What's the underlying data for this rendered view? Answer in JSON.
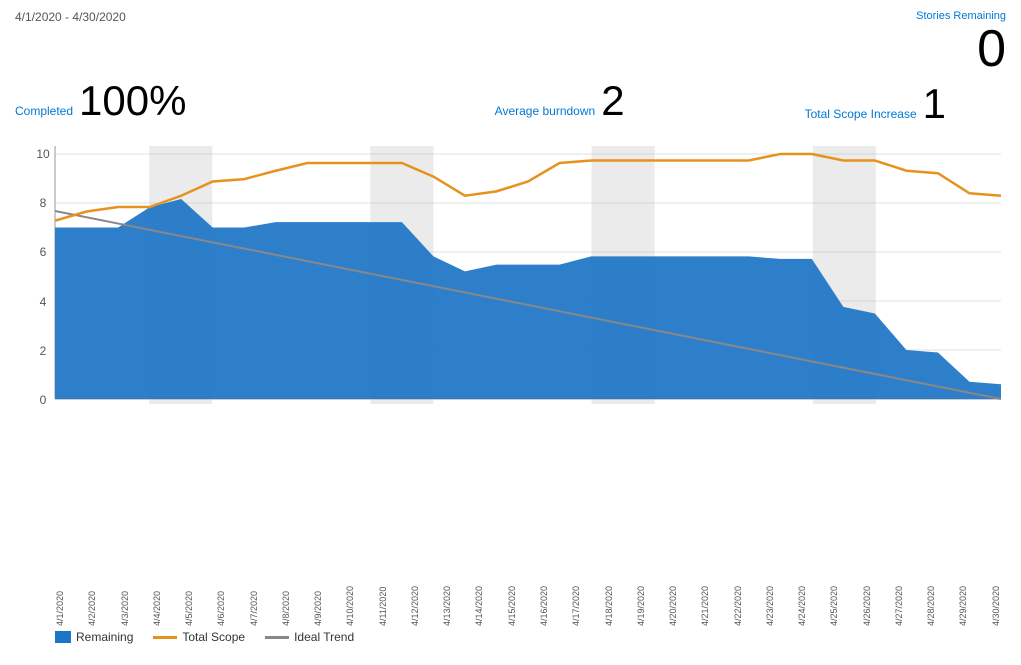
{
  "header": {
    "date_range": "4/1/2020 - 4/30/2020",
    "stories_remaining_label": "Stories Remaining",
    "stories_remaining_value": "0"
  },
  "stats": {
    "completed_label": "Completed",
    "completed_value": "100%",
    "average_burndown_label": "Average burndown",
    "average_burndown_value": "2",
    "total_scope_label": "Total Scope Increase",
    "total_scope_value": "1"
  },
  "legend": {
    "remaining_label": "Remaining",
    "total_scope_label": "Total Scope",
    "ideal_trend_label": "Ideal Trend"
  },
  "chart": {
    "colors": {
      "remaining_fill": "#1b74c5",
      "total_scope_line": "#e6921e",
      "ideal_trend_line": "#888",
      "weekend_fill": "rgba(180,180,180,0.35)",
      "axis": "#ccc",
      "text": "#555"
    }
  }
}
